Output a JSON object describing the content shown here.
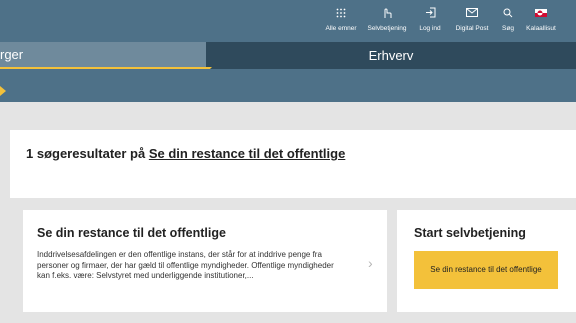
{
  "topnav": {
    "items": [
      {
        "label": "Alle emner",
        "icon": "grid-icon"
      },
      {
        "label": "Selvbetjening",
        "icon": "pointer-hand-icon"
      },
      {
        "label": "Log ind",
        "icon": "login-icon"
      },
      {
        "label": "Digital Post",
        "icon": "mail-icon"
      },
      {
        "label": "Søg",
        "icon": "search-icon"
      },
      {
        "label": "Kalaallisut",
        "icon": "greenland-flag-icon"
      }
    ]
  },
  "tabs": {
    "left_label": "rger",
    "right_label": "Erhverv"
  },
  "results": {
    "prefix": "1 søgeresultater på",
    "query": "Se din restance til det offentlige"
  },
  "result": {
    "title": "Se din restance til det offentlige",
    "description": "Inddrivelsesafdelingen er den offentlige instans, der står for at inddrive penge fra personer og firmaer, der har gæld til offentlige myndigheder. Offentlige myndigheder kan f.eks. være: Selvstyret med underliggende institutioner,..."
  },
  "side": {
    "title": "Start selvbetjening",
    "button_label": "Se din restance til det offentlige"
  },
  "colors": {
    "header_bg": "#4e7188",
    "tab_active_bg": "#6f8a9c",
    "tab_inactive_bg": "#2f4a5c",
    "accent": "#f3c13a",
    "page_bg": "#e4e4e4"
  }
}
